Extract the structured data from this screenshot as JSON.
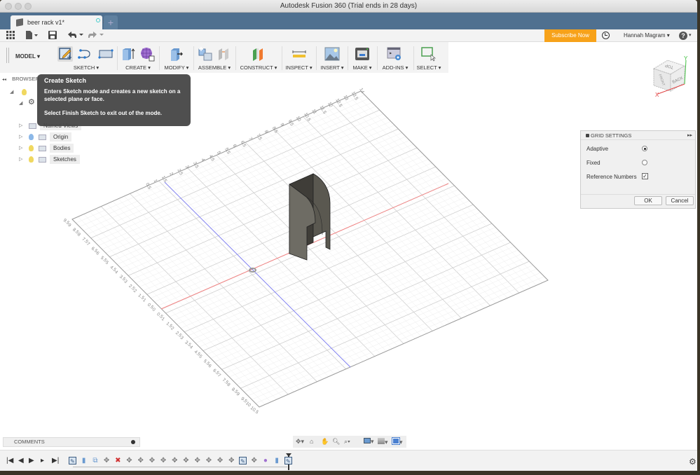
{
  "window": {
    "title": "Autodesk Fusion 360 (Trial ends in 28 days)"
  },
  "tabs": {
    "document_tab": "beer rack v1*",
    "close_glyph": "×",
    "new_tab_glyph": "+"
  },
  "quick_access": {
    "apps_icon": "grid-icon",
    "file_icon": "file-icon",
    "save_icon": "save-icon",
    "undo_icon": "undo-icon",
    "redo_icon": "redo-icon",
    "subscribe_label": "Subscribe Now",
    "user_label": "Hannah Magram ▾",
    "help_glyph": "?",
    "caret": "▾"
  },
  "ribbon": {
    "workspace": "MODEL ▾",
    "groups": [
      {
        "label": "SKETCH ▾"
      },
      {
        "label": "CREATE ▾"
      },
      {
        "label": "MODIFY ▾"
      },
      {
        "label": "ASSEMBLE ▾"
      },
      {
        "label": "CONSTRUCT ▾"
      },
      {
        "label": "INSPECT ▾"
      },
      {
        "label": "INSERT ▾"
      },
      {
        "label": "MAKE ▾"
      },
      {
        "label": "ADD-INS ▾"
      },
      {
        "label": "SELECT ▾"
      }
    ]
  },
  "tooltip": {
    "title": "Create Sketch",
    "body": "Enters Sketch mode and creates a new sketch on a selected plane or face.",
    "body2": "Select Finish Sketch to exit out of the mode."
  },
  "browser": {
    "header": "BROWSER",
    "collapse_glyph": "◂◂",
    "items": [
      {
        "label": "Named Views",
        "bulb": false
      },
      {
        "label": "Origin",
        "bulb": "blue"
      },
      {
        "label": "Bodies",
        "bulb": "yellow"
      },
      {
        "label": "Sketches",
        "bulb": "yellow"
      }
    ]
  },
  "grid_settings": {
    "title": "GRID SETTINGS",
    "options": [
      {
        "label": "Adaptive",
        "type": "radio",
        "checked": true
      },
      {
        "label": "Fixed",
        "type": "radio",
        "checked": false
      },
      {
        "label": "Reference Numbers",
        "type": "checkbox",
        "checked": true
      }
    ],
    "ok_label": "OK",
    "cancel_label": "Cancel"
  },
  "viewcube": {
    "faces": [
      "TOP",
      "FRONT",
      "BACK"
    ],
    "axes": [
      "X",
      "Y"
    ]
  },
  "grid": {
    "ruler_top_labels": [
      "0.5",
      "1",
      "1.5",
      "2",
      "2.5",
      "3",
      "3.5",
      "4",
      "4.5",
      "5",
      "5.5",
      "6",
      "6.5",
      "7",
      "7.5",
      "8",
      "8.5",
      "9",
      "9.5",
      "10",
      "10.5",
      "11",
      "11.5",
      "12",
      "12.5",
      "13",
      "13.5",
      "14"
    ],
    "ruler_left_labels": [
      "9.5",
      "9",
      "8.5",
      "8",
      "7.5",
      "7",
      "6.5",
      "6",
      "5.5",
      "5",
      "4.5",
      "4",
      "3.5",
      "3",
      "2.5",
      "2",
      "1.5",
      "1",
      "0.5",
      "0",
      "0.5",
      "1",
      "1.5",
      "2",
      "2.5",
      "3",
      "3.5",
      "4",
      "4.5",
      "5",
      "5.5",
      "6",
      "6.5",
      "7",
      "7.5",
      "8",
      "8.5",
      "9",
      "9.5",
      "10",
      "10.5"
    ],
    "colors": {
      "x_axis": "#f08080",
      "y_axis": "#8080f0",
      "major": "#cfcfcf",
      "minor": "#ececec",
      "border": "#999999"
    }
  },
  "comments": {
    "label": "COMMENTS"
  },
  "timeline": {
    "controls": [
      "⏮",
      "◀",
      "▶",
      "▶",
      "⏭"
    ],
    "items": [
      "sketch",
      "extrude",
      "mirror",
      "move",
      "delete-combine",
      "move",
      "move",
      "move",
      "move",
      "move",
      "move",
      "move",
      "move",
      "move",
      "move",
      "sketch",
      "move",
      "form",
      "extrude",
      "sketch"
    ]
  },
  "navbar": {
    "tools": [
      "orbit-icon",
      "look-at-icon",
      "pan-icon",
      "zoom-icon",
      "zoom-window-icon",
      "display-settings-icon",
      "visual-style-icon",
      "viewports-icon"
    ]
  }
}
